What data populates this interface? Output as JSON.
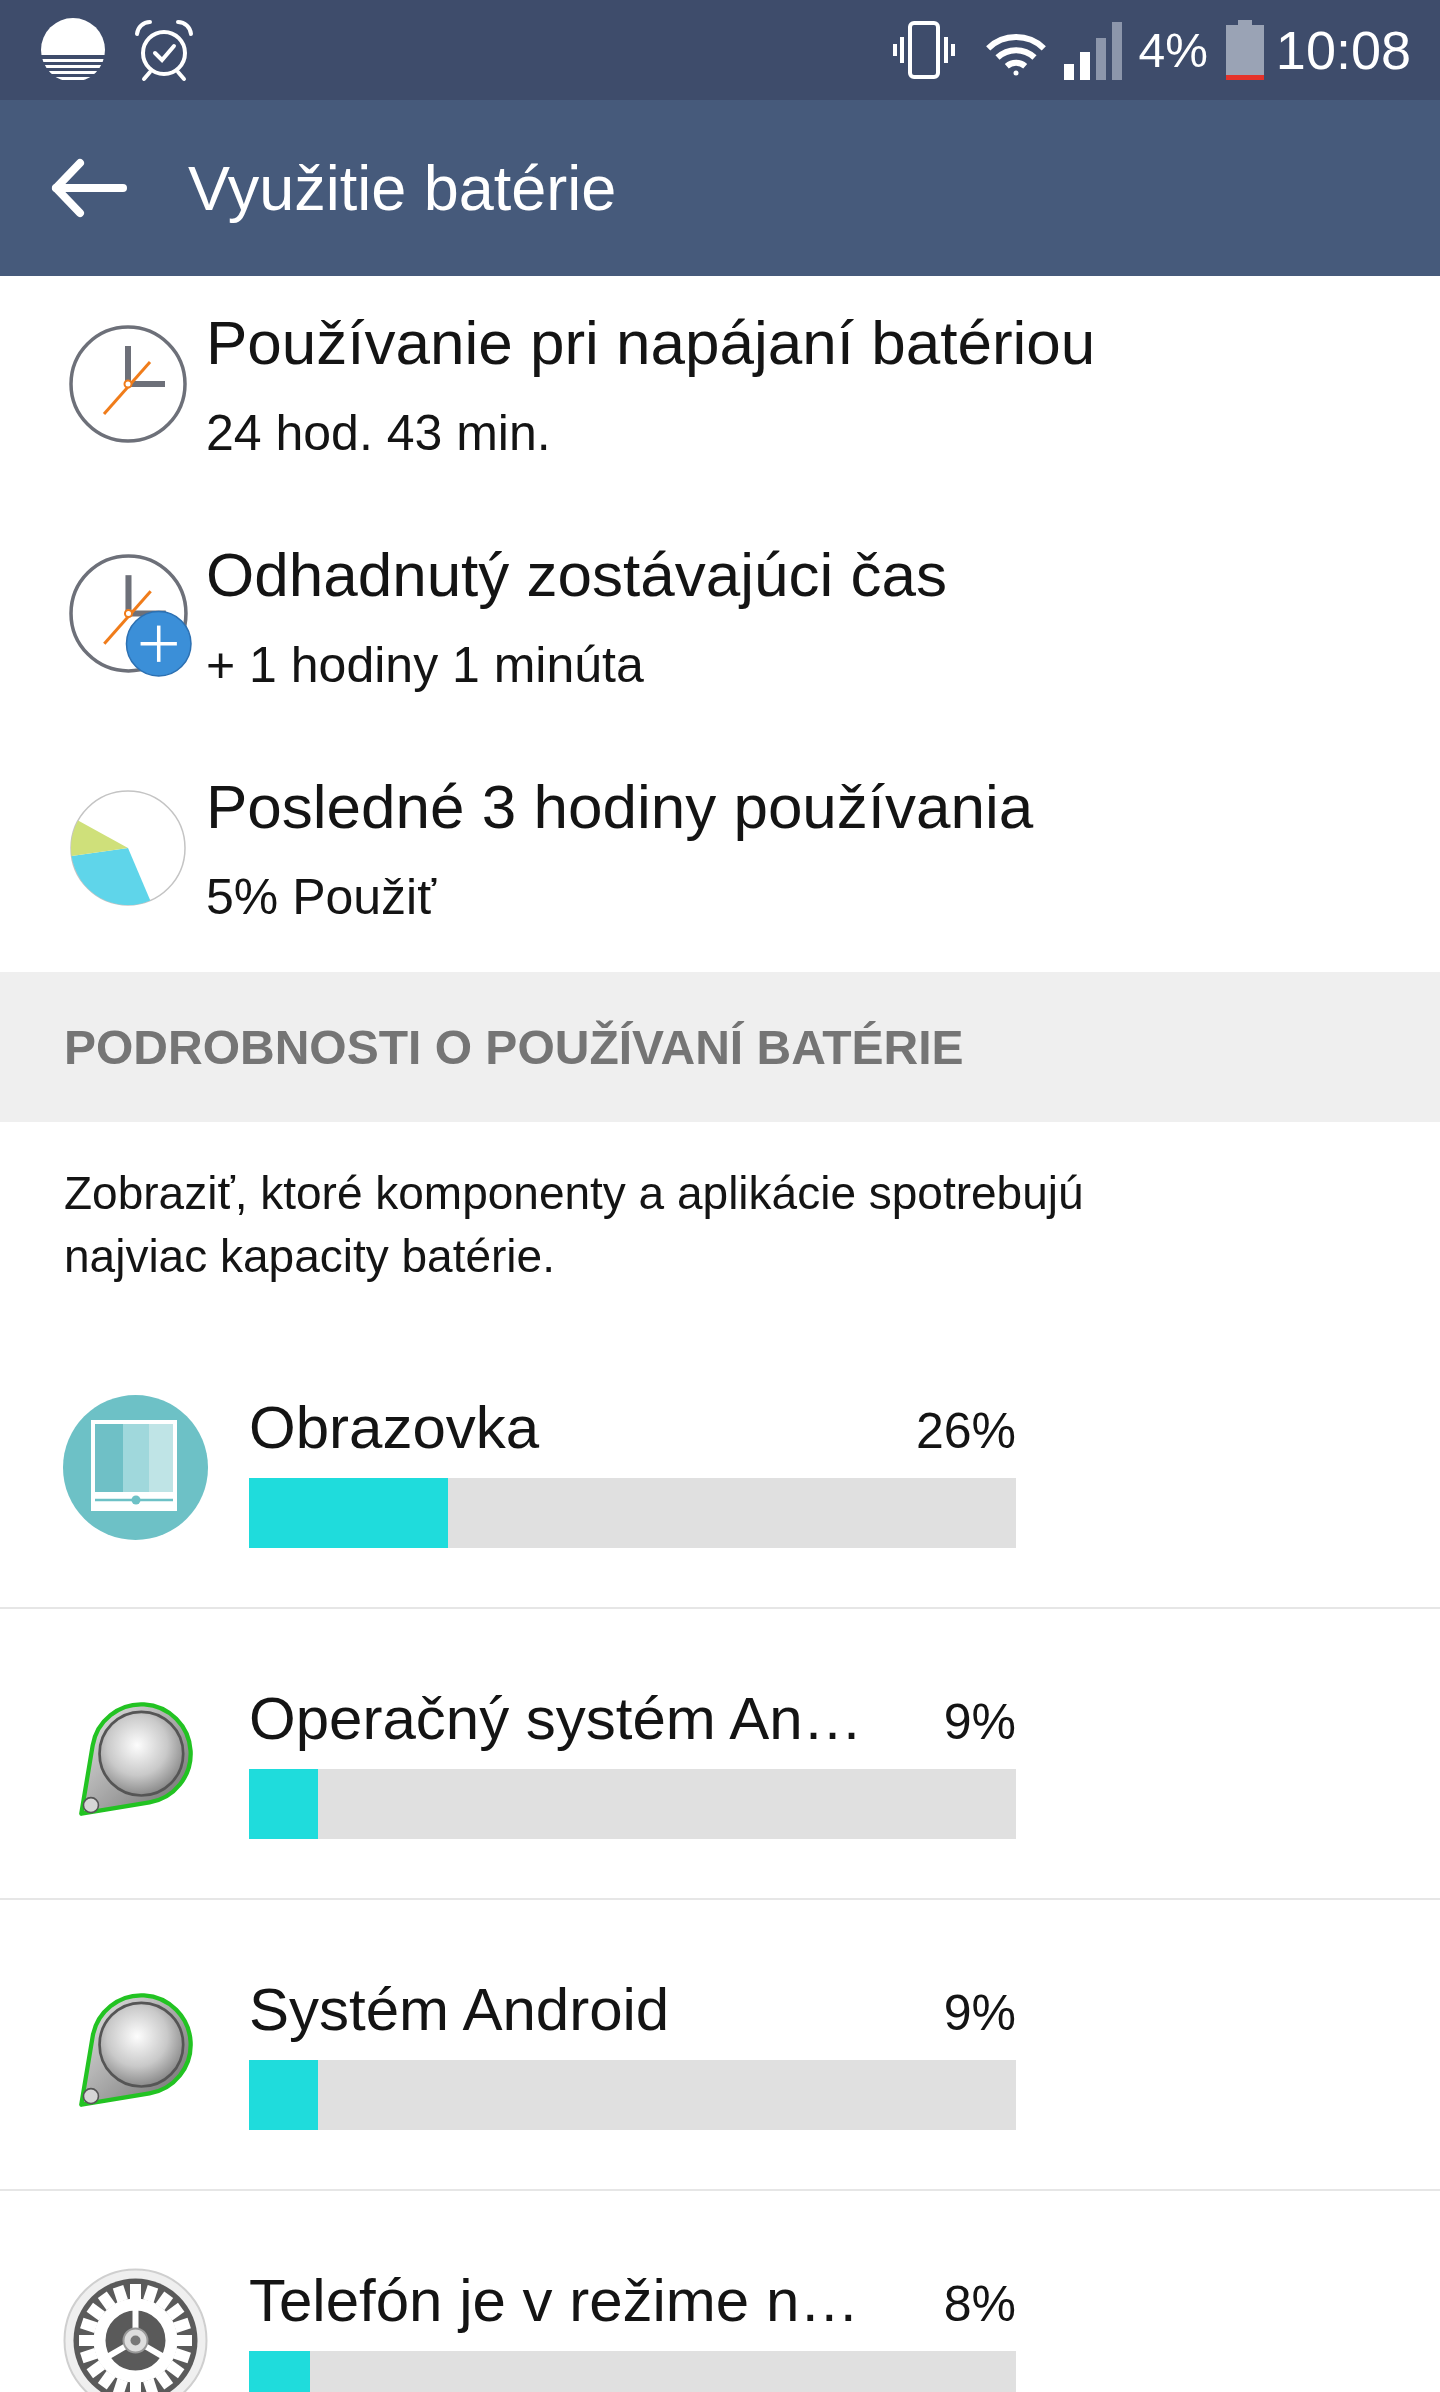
{
  "status_bar": {
    "battery": "4%",
    "time": "10:08"
  },
  "app_bar": {
    "title": "Využitie batérie"
  },
  "summary": [
    {
      "kind": "clock",
      "title": "Používanie pri napájaní batériou",
      "value": "24 hod. 43 min."
    },
    {
      "kind": "clock_plus",
      "title": "Odhadnutý zostávajúci čas",
      "value": "+ 1 hodiny 1 minúta"
    },
    {
      "kind": "pie",
      "title": "Posledné 3 hodiny používania",
      "value": "5% Použiť"
    }
  ],
  "details": {
    "heading": "PODROBNOSTI O POUŽÍVANÍ BATÉRIE",
    "description": "Zobraziť, ktoré komponenty a aplikácie spotrebujú najviac kapacity batérie."
  },
  "apps": [
    {
      "kind": "screen",
      "name": "Obrazovka",
      "percent": "26%",
      "level": 0.26
    },
    {
      "kind": "system",
      "name": "Operačný systém An…",
      "percent": "9%",
      "level": 0.09
    },
    {
      "kind": "system",
      "name": "Systém Android",
      "percent": "9%",
      "level": 0.09
    },
    {
      "kind": "settings",
      "name": "Telefón je v režime n…",
      "percent": "8%",
      "level": 0.08
    }
  ]
}
